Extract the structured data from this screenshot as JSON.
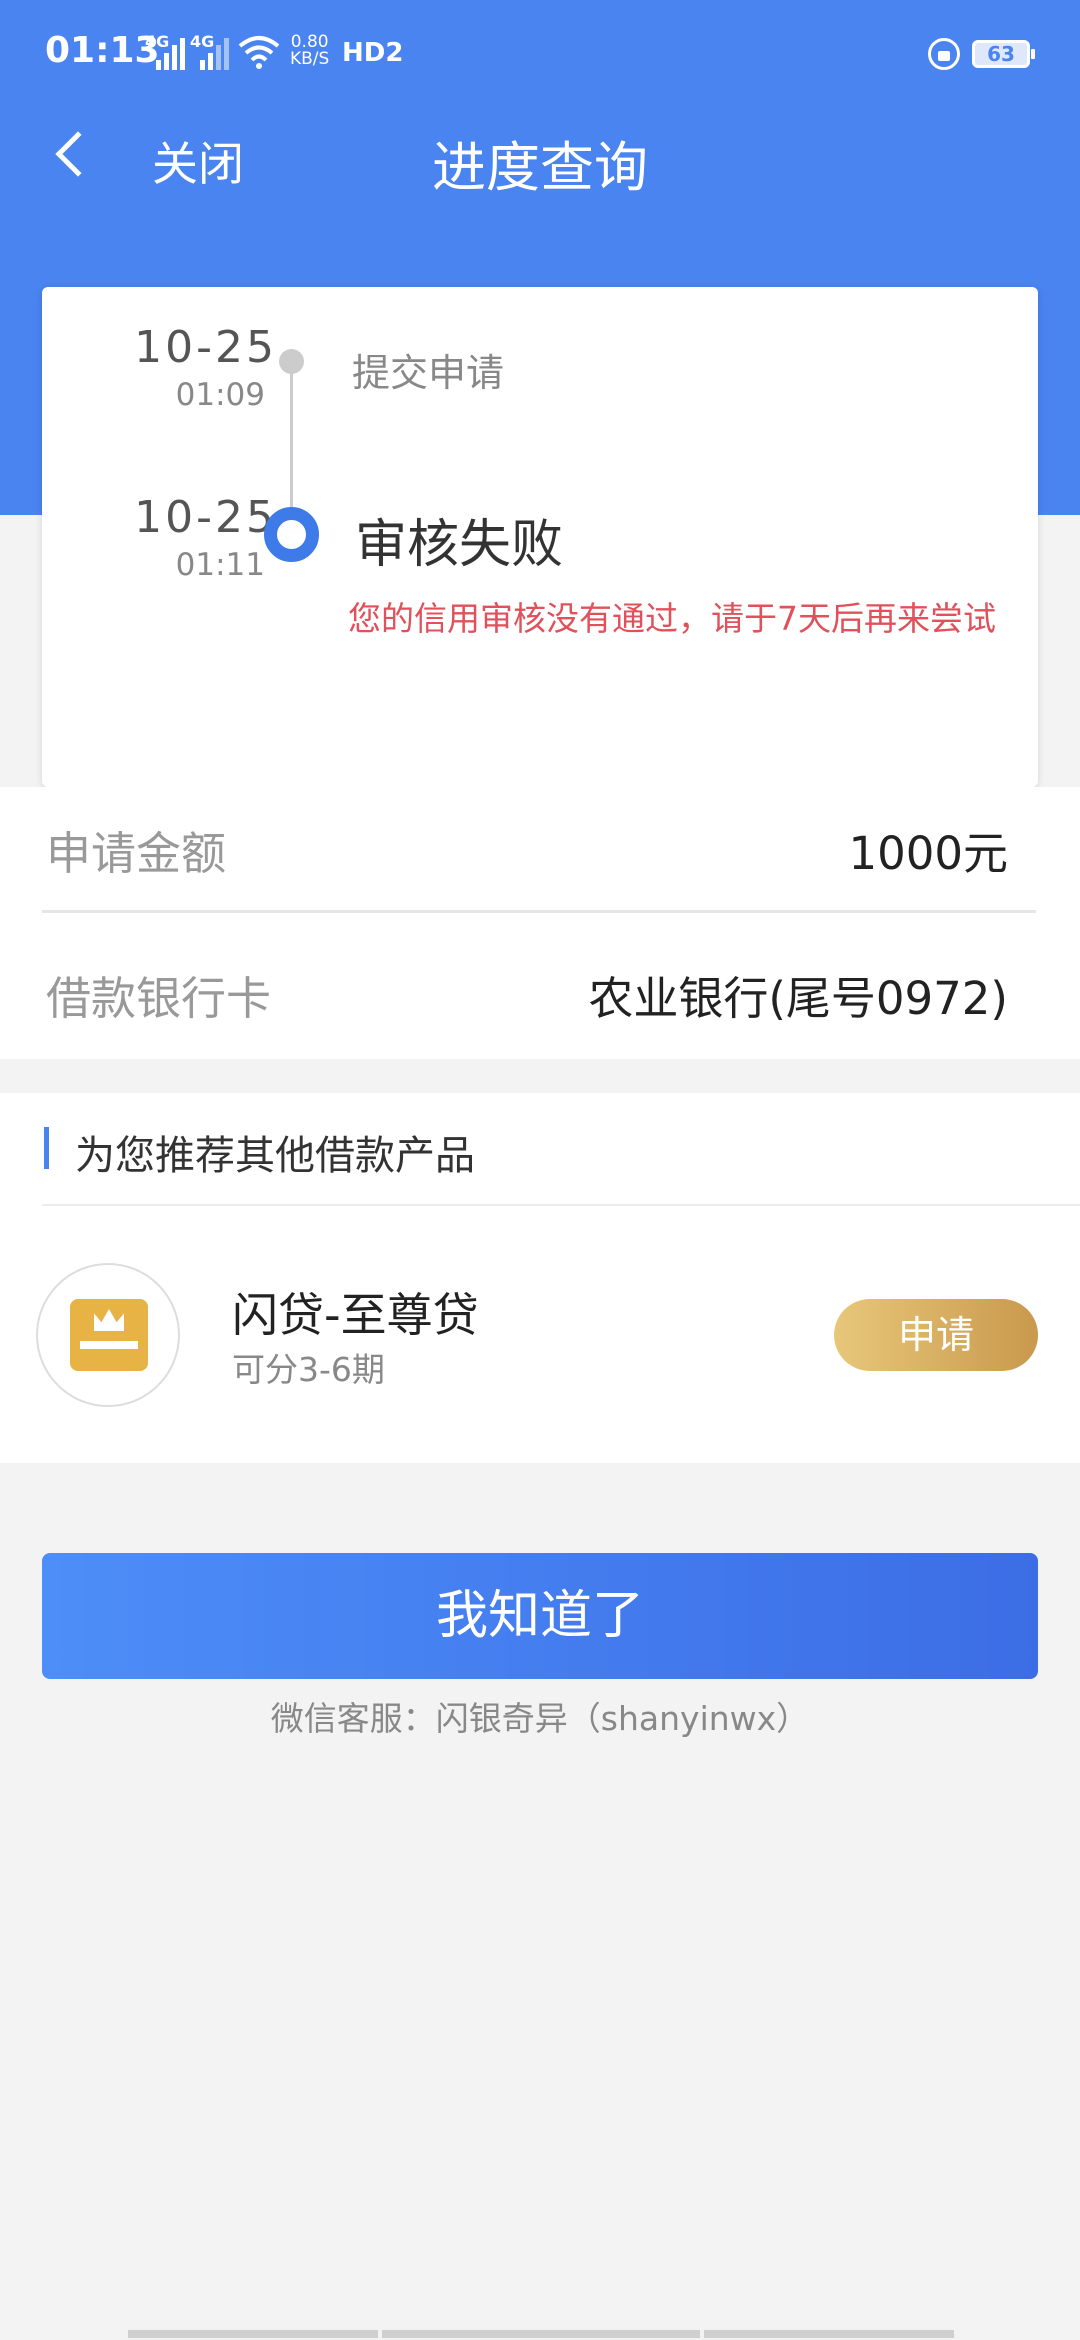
{
  "status_bar": {
    "time": "01:13",
    "network1": "4G",
    "network2": "4G",
    "speed_value": "0.80",
    "speed_unit": "KB/S",
    "hd": "HD2",
    "battery": "63"
  },
  "nav": {
    "close_label": "关闭",
    "title": "进度查询"
  },
  "timeline": [
    {
      "date": "10-25",
      "time": "01:09",
      "label": "提交申请"
    },
    {
      "date": "10-25",
      "time": "01:11",
      "label": "审核失败",
      "message": "您的信用审核没有通过，请于7天后再来尝试"
    }
  ],
  "info": {
    "amount_label": "申请金额",
    "amount_value": "1000元",
    "card_label": "借款银行卡",
    "card_value": "农业银行(尾号0972)"
  },
  "recommend": {
    "title": "为您推荐其他借款产品",
    "product": {
      "name": "闪贷-至尊贷",
      "subtitle": "可分3-6期",
      "apply_label": "申请"
    }
  },
  "confirm_label": "我知道了",
  "service_text": "微信客服：闪银奇异（shanyinwx）",
  "colors": {
    "header": "#4a84f0",
    "accent_blue": "#3e7ae8",
    "error_red": "#e0515b",
    "gold": "#c9994d"
  }
}
